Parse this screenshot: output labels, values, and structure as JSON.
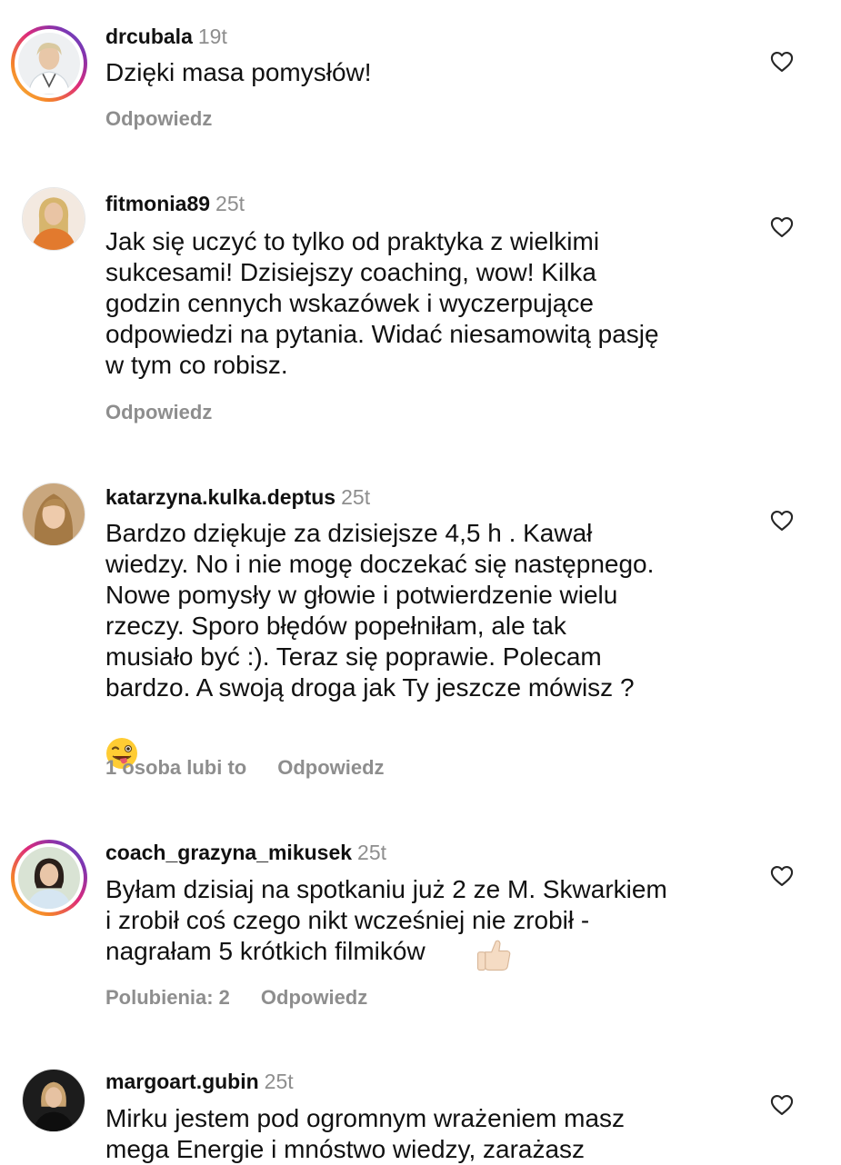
{
  "comments": [
    {
      "username": "drcubala",
      "time": "19t",
      "text": "Dzięki masa pomysłów!",
      "reply_label": "Odpowiedz",
      "likes_label": "",
      "avatar": "woman-doctor-avatar",
      "story_ring": true
    },
    {
      "username": "fitmonia89",
      "time": "25t",
      "text": "Jak się uczyć to tylko od praktyka z wielkimi\nsukcesami! Dzisiejszy coaching, wow! Kilka\ngodzin cennych wskazówek i wyczerpujące\nodpowiedzi na pytania.  Widać niesamowitą pasję\nw tym co robisz.",
      "reply_label": "Odpowiedz",
      "likes_label": "",
      "avatar": "woman-blonde-avatar",
      "story_ring": false
    },
    {
      "username": "katarzyna.kulka.deptus",
      "time": "25t",
      "text": "Bardzo dziękuje za dzisiejsze 4,5 h . Kawał\nwiedzy. No i nie mogę doczekać się następnego.\nNowe pomysły w głowie i potwierdzenie wielu\nrzeczy. Sporo błędów popełniłam, ale tak\nmusiało być :). Teraz się poprawie. Polecam\nbardzo. A swoją droga jak Ty jeszcze mówisz ?",
      "emoji": "winking-face-with-tongue-emoji",
      "reply_label": "Odpowiedz",
      "likes_label": "1 osoba lubi to",
      "avatar": "woman-longhair-avatar",
      "story_ring": false
    },
    {
      "username": "coach_grazyna_mikusek",
      "time": "25t",
      "text": "Byłam dzisiaj na spotkaniu już 2 ze M. Skwarkiem\ni zrobił coś czego nikt wcześniej nie zrobił -\nnagrałam 5 krótkich filmików",
      "emoji": "thumbs-up-emoji",
      "reply_label": "Odpowiedz",
      "likes_label": "Polubienia: 2",
      "avatar": "woman-darkhair-avatar",
      "story_ring": true
    },
    {
      "username": "margoart.gubin",
      "time": "25t",
      "text": "Mirku jestem pod ogromnym wrażeniem masz\nmega Energie i mnóstwo wiedzy, zarażasz",
      "reply_label": "",
      "likes_label": "",
      "avatar": "woman-dark-avatar",
      "story_ring": false
    }
  ],
  "colors": {
    "username": "#111111",
    "muted": "#8e8e8e",
    "story_ring_start": "#f9c23c",
    "story_ring_end": "#8134af"
  },
  "icons": {
    "like": "heart-outline-icon"
  }
}
